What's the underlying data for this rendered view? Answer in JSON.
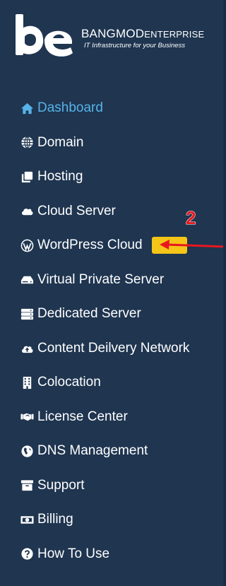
{
  "brand": {
    "name_main": "BANGMOD",
    "name_sub": "ENTERPRISE",
    "tagline": "IT Infrastructure for your Business",
    "colors": {
      "sidebar_bg": "#1f3550",
      "active": "#56b3e8",
      "text": "#ffffff",
      "badge": "#f5c518",
      "annotation": "#e8171f"
    }
  },
  "menu": {
    "items": [
      {
        "label": "Dashboard",
        "icon": "home-icon",
        "active": true
      },
      {
        "label": "Domain",
        "icon": "globe-icon"
      },
      {
        "label": "Hosting",
        "icon": "clone-icon"
      },
      {
        "label": "Cloud Server",
        "icon": "cloud-icon"
      },
      {
        "label": "WordPress Cloud",
        "icon": "wordpress-icon"
      },
      {
        "label": "Virtual Private Server",
        "icon": "hdd-icon"
      },
      {
        "label": "Dedicated Server",
        "icon": "server-icon"
      },
      {
        "label": "Content Deilvery Network",
        "icon": "cloud-upload-icon"
      },
      {
        "label": "Colocation",
        "icon": "building-icon"
      },
      {
        "label": "License Center",
        "icon": "handshake-icon"
      },
      {
        "label": "DNS Management",
        "icon": "globe-africa-icon"
      },
      {
        "label": "Support",
        "icon": "archive-icon"
      },
      {
        "label": "Billing",
        "icon": "money-bill-icon"
      },
      {
        "label": "How To Use",
        "icon": "question-circle-icon"
      }
    ]
  },
  "annotation": {
    "number": "2"
  }
}
